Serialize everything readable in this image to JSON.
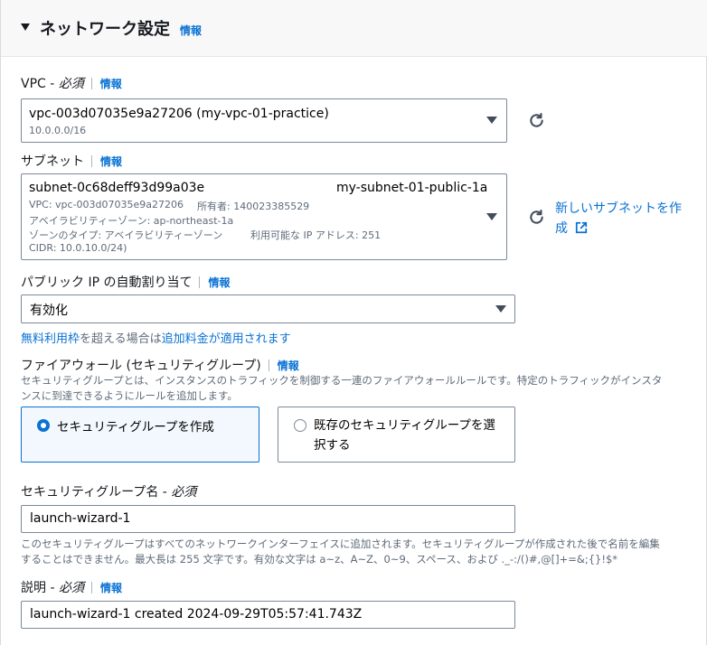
{
  "section": {
    "title": "ネットワーク設定",
    "info": "情報"
  },
  "vpc": {
    "label": "VPC - ",
    "required": "必須",
    "info": "情報",
    "selected_id": "vpc-003d07035e9a27206 (my-vpc-01-practice)",
    "cidr": "10.0.0.0/16"
  },
  "subnet": {
    "label": "サブネット",
    "info": "情報",
    "selected_id": "subnet-0c68deff93d99a03e",
    "selected_name": "my-subnet-01-public-1a",
    "vpc_line": "VPC: vpc-003d07035e9a27206",
    "owner_line": "所有者: 140023385529",
    "az_line": "アベイラビリティーゾーン: ap-northeast-1a",
    "zone_type_line": "ゾーンのタイプ: アベイラビリティーゾーン",
    "ip_line": "利用可能な IP アドレス: 251",
    "cidr_line": "CIDR: 10.0.10.0/24)",
    "create_link_line1": "新しいサブネットを作",
    "create_link_line2": "成"
  },
  "public_ip": {
    "label": "パブリック IP の自動割り当て",
    "info": "情報",
    "value": "有効化",
    "free_tier_link": "無料利用枠",
    "free_tier_text": "を超える場合は",
    "charges_link": "追加料金が適用されます"
  },
  "firewall": {
    "label": "ファイアウォール (セキュリティグループ)",
    "info": "情報",
    "description_line1": "セキュリティグループとは、インスタンスのトラフィックを制御する一連のファイアウォールルールです。特定のトラフィックがインスタ",
    "description_line2": "ンスに到達できるようにルールを追加します。",
    "option_create": "セキュリティグループを作成",
    "option_existing_line1": "既存のセキュリティグループを選",
    "option_existing_line2": "択する"
  },
  "sg_name": {
    "label": "セキュリティグループ名 - ",
    "required": "必須",
    "value": "launch-wizard-1",
    "description_line1": "このセキュリティグループはすべてのネットワークインターフェイスに追加されます。セキュリティグループが作成された後で名前を編集",
    "description_line2": "することはできません。最大長は 255 文字です。有効な文字は a~z、A~Z、0~9、スペース、および ._-:/()#,@[]+=&;{}!$*"
  },
  "description_field": {
    "label": "説明 - ",
    "required": "必須",
    "info": "情報",
    "value": "launch-wizard-1 created 2024-09-29T05:57:41.743Z"
  },
  "icons": {
    "collapse": "caret-down-icon",
    "refresh": "refresh-icon",
    "external": "external-link-icon"
  },
  "colors": {
    "link": "#0972d3",
    "header_bg": "#f8f8f8",
    "selected_tile_bg": "#f2f8fd"
  }
}
